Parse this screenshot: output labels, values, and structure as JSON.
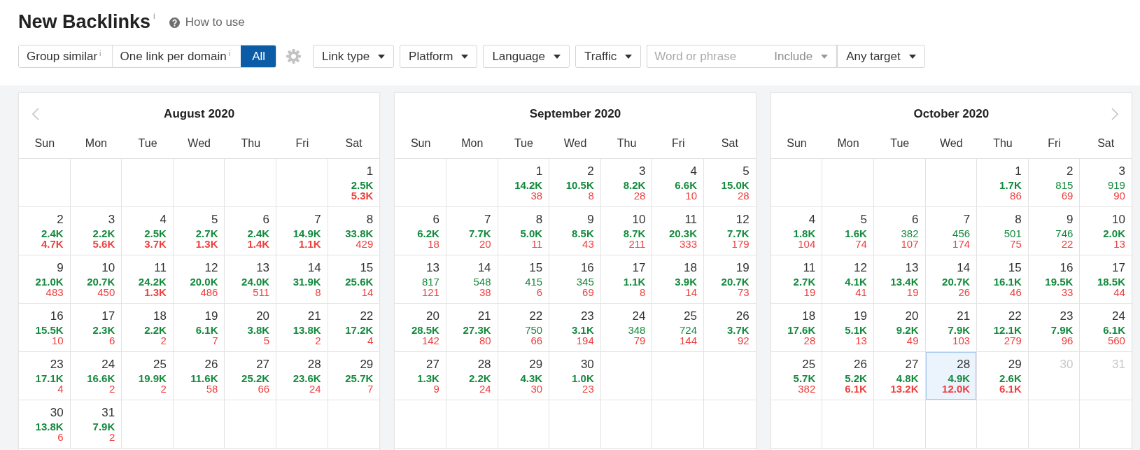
{
  "page": {
    "title": "New Backlinks",
    "title_info": "i",
    "help_link": "How to use"
  },
  "toolbar": {
    "segments": [
      {
        "label": "Group similar",
        "info": "i",
        "selected": false
      },
      {
        "label": "One link per domain",
        "info": "i",
        "selected": false
      },
      {
        "label": "All",
        "selected": true
      }
    ],
    "filters": [
      {
        "label": "Link type"
      },
      {
        "label": "Platform"
      },
      {
        "label": "Language"
      },
      {
        "label": "Traffic"
      }
    ],
    "search": {
      "placeholder": "Word or phrase",
      "dropdowns": [
        {
          "label": "Include",
          "disabled": true
        },
        {
          "label": "Any target",
          "disabled": false
        }
      ]
    }
  },
  "months": [
    {
      "title": "August 2020",
      "prev_arrow": true,
      "weekdays": [
        "Sun",
        "Mon",
        "Tue",
        "Wed",
        "Thu",
        "Fri",
        "Sat"
      ],
      "weeks": [
        [
          {
            "kind": "blank"
          },
          {
            "kind": "blank"
          },
          {
            "kind": "blank"
          },
          {
            "kind": "blank"
          },
          {
            "kind": "blank"
          },
          {
            "kind": "blank"
          },
          {
            "kind": "day",
            "day": "1",
            "new": "2.5K",
            "new_bold": true,
            "lost": "5.3K",
            "lost_bold": true,
            "selected": false,
            "disabled": false
          }
        ],
        [
          {
            "kind": "day",
            "day": "2",
            "new": "2.4K",
            "new_bold": true,
            "lost": "4.7K",
            "lost_bold": true,
            "selected": false,
            "disabled": false
          },
          {
            "kind": "day",
            "day": "3",
            "new": "2.2K",
            "new_bold": true,
            "lost": "5.6K",
            "lost_bold": true,
            "selected": false,
            "disabled": false
          },
          {
            "kind": "day",
            "day": "4",
            "new": "2.5K",
            "new_bold": true,
            "lost": "3.7K",
            "lost_bold": true,
            "selected": false,
            "disabled": false
          },
          {
            "kind": "day",
            "day": "5",
            "new": "2.7K",
            "new_bold": true,
            "lost": "1.3K",
            "lost_bold": true,
            "selected": false,
            "disabled": false
          },
          {
            "kind": "day",
            "day": "6",
            "new": "2.4K",
            "new_bold": true,
            "lost": "1.4K",
            "lost_bold": true,
            "selected": false,
            "disabled": false
          },
          {
            "kind": "day",
            "day": "7",
            "new": "14.9K",
            "new_bold": true,
            "lost": "1.1K",
            "lost_bold": true,
            "selected": false,
            "disabled": false
          },
          {
            "kind": "day",
            "day": "8",
            "new": "33.8K",
            "new_bold": true,
            "lost": "429",
            "lost_bold": false,
            "selected": false,
            "disabled": false
          }
        ],
        [
          {
            "kind": "day",
            "day": "9",
            "new": "21.0K",
            "new_bold": true,
            "lost": "483",
            "lost_bold": false,
            "selected": false,
            "disabled": false
          },
          {
            "kind": "day",
            "day": "10",
            "new": "20.7K",
            "new_bold": true,
            "lost": "450",
            "lost_bold": false,
            "selected": false,
            "disabled": false
          },
          {
            "kind": "day",
            "day": "11",
            "new": "24.2K",
            "new_bold": true,
            "lost": "1.3K",
            "lost_bold": true,
            "selected": false,
            "disabled": false
          },
          {
            "kind": "day",
            "day": "12",
            "new": "20.0K",
            "new_bold": true,
            "lost": "486",
            "lost_bold": false,
            "selected": false,
            "disabled": false
          },
          {
            "kind": "day",
            "day": "13",
            "new": "24.0K",
            "new_bold": true,
            "lost": "511",
            "lost_bold": false,
            "selected": false,
            "disabled": false
          },
          {
            "kind": "day",
            "day": "14",
            "new": "31.9K",
            "new_bold": true,
            "lost": "8",
            "lost_bold": false,
            "selected": false,
            "disabled": false
          },
          {
            "kind": "day",
            "day": "15",
            "new": "25.6K",
            "new_bold": true,
            "lost": "14",
            "lost_bold": false,
            "selected": false,
            "disabled": false
          }
        ],
        [
          {
            "kind": "day",
            "day": "16",
            "new": "15.5K",
            "new_bold": true,
            "lost": "10",
            "lost_bold": false,
            "selected": false,
            "disabled": false
          },
          {
            "kind": "day",
            "day": "17",
            "new": "2.3K",
            "new_bold": true,
            "lost": "6",
            "lost_bold": false,
            "selected": false,
            "disabled": false
          },
          {
            "kind": "day",
            "day": "18",
            "new": "2.2K",
            "new_bold": true,
            "lost": "2",
            "lost_bold": false,
            "selected": false,
            "disabled": false
          },
          {
            "kind": "day",
            "day": "19",
            "new": "6.1K",
            "new_bold": true,
            "lost": "7",
            "lost_bold": false,
            "selected": false,
            "disabled": false
          },
          {
            "kind": "day",
            "day": "20",
            "new": "3.8K",
            "new_bold": true,
            "lost": "5",
            "lost_bold": false,
            "selected": false,
            "disabled": false
          },
          {
            "kind": "day",
            "day": "21",
            "new": "13.8K",
            "new_bold": true,
            "lost": "2",
            "lost_bold": false,
            "selected": false,
            "disabled": false
          },
          {
            "kind": "day",
            "day": "22",
            "new": "17.2K",
            "new_bold": true,
            "lost": "4",
            "lost_bold": false,
            "selected": false,
            "disabled": false
          }
        ],
        [
          {
            "kind": "day",
            "day": "23",
            "new": "17.1K",
            "new_bold": true,
            "lost": "4",
            "lost_bold": false,
            "selected": false,
            "disabled": false
          },
          {
            "kind": "day",
            "day": "24",
            "new": "16.6K",
            "new_bold": true,
            "lost": "2",
            "lost_bold": false,
            "selected": false,
            "disabled": false
          },
          {
            "kind": "day",
            "day": "25",
            "new": "19.9K",
            "new_bold": true,
            "lost": "2",
            "lost_bold": false,
            "selected": false,
            "disabled": false
          },
          {
            "kind": "day",
            "day": "26",
            "new": "11.6K",
            "new_bold": true,
            "lost": "58",
            "lost_bold": false,
            "selected": false,
            "disabled": false
          },
          {
            "kind": "day",
            "day": "27",
            "new": "25.2K",
            "new_bold": true,
            "lost": "66",
            "lost_bold": false,
            "selected": false,
            "disabled": false
          },
          {
            "kind": "day",
            "day": "28",
            "new": "23.6K",
            "new_bold": true,
            "lost": "24",
            "lost_bold": false,
            "selected": false,
            "disabled": false
          },
          {
            "kind": "day",
            "day": "29",
            "new": "25.7K",
            "new_bold": true,
            "lost": "7",
            "lost_bold": false,
            "selected": false,
            "disabled": false
          }
        ],
        [
          {
            "kind": "day",
            "day": "30",
            "new": "13.8K",
            "new_bold": true,
            "lost": "6",
            "lost_bold": false,
            "selected": false,
            "disabled": false
          },
          {
            "kind": "day",
            "day": "31",
            "new": "7.9K",
            "new_bold": true,
            "lost": "2",
            "lost_bold": false,
            "selected": false,
            "disabled": false
          },
          {
            "kind": "blank"
          },
          {
            "kind": "blank"
          },
          {
            "kind": "blank"
          },
          {
            "kind": "blank"
          },
          {
            "kind": "blank"
          }
        ]
      ]
    },
    {
      "title": "September 2020",
      "weekdays": [
        "Sun",
        "Mon",
        "Tue",
        "Wed",
        "Thu",
        "Fri",
        "Sat"
      ],
      "weeks": [
        [
          {
            "kind": "blank"
          },
          {
            "kind": "blank"
          },
          {
            "kind": "day",
            "day": "1",
            "new": "14.2K",
            "new_bold": true,
            "lost": "38",
            "lost_bold": false,
            "selected": false,
            "disabled": false
          },
          {
            "kind": "day",
            "day": "2",
            "new": "10.5K",
            "new_bold": true,
            "lost": "8",
            "lost_bold": false,
            "selected": false,
            "disabled": false
          },
          {
            "kind": "day",
            "day": "3",
            "new": "8.2K",
            "new_bold": true,
            "lost": "28",
            "lost_bold": false,
            "selected": false,
            "disabled": false
          },
          {
            "kind": "day",
            "day": "4",
            "new": "6.6K",
            "new_bold": true,
            "lost": "10",
            "lost_bold": false,
            "selected": false,
            "disabled": false
          },
          {
            "kind": "day",
            "day": "5",
            "new": "15.0K",
            "new_bold": true,
            "lost": "28",
            "lost_bold": false,
            "selected": false,
            "disabled": false
          }
        ],
        [
          {
            "kind": "day",
            "day": "6",
            "new": "6.2K",
            "new_bold": true,
            "lost": "18",
            "lost_bold": false,
            "selected": false,
            "disabled": false
          },
          {
            "kind": "day",
            "day": "7",
            "new": "7.7K",
            "new_bold": true,
            "lost": "20",
            "lost_bold": false,
            "selected": false,
            "disabled": false
          },
          {
            "kind": "day",
            "day": "8",
            "new": "5.0K",
            "new_bold": true,
            "lost": "11",
            "lost_bold": false,
            "selected": false,
            "disabled": false
          },
          {
            "kind": "day",
            "day": "9",
            "new": "8.5K",
            "new_bold": true,
            "lost": "43",
            "lost_bold": false,
            "selected": false,
            "disabled": false
          },
          {
            "kind": "day",
            "day": "10",
            "new": "8.7K",
            "new_bold": true,
            "lost": "211",
            "lost_bold": false,
            "selected": false,
            "disabled": false
          },
          {
            "kind": "day",
            "day": "11",
            "new": "20.3K",
            "new_bold": true,
            "lost": "333",
            "lost_bold": false,
            "selected": false,
            "disabled": false
          },
          {
            "kind": "day",
            "day": "12",
            "new": "7.7K",
            "new_bold": true,
            "lost": "179",
            "lost_bold": false,
            "selected": false,
            "disabled": false
          }
        ],
        [
          {
            "kind": "day",
            "day": "13",
            "new": "817",
            "new_bold": false,
            "lost": "121",
            "lost_bold": false,
            "selected": false,
            "disabled": false
          },
          {
            "kind": "day",
            "day": "14",
            "new": "548",
            "new_bold": false,
            "lost": "38",
            "lost_bold": false,
            "selected": false,
            "disabled": false
          },
          {
            "kind": "day",
            "day": "15",
            "new": "415",
            "new_bold": false,
            "lost": "6",
            "lost_bold": false,
            "selected": false,
            "disabled": false
          },
          {
            "kind": "day",
            "day": "16",
            "new": "345",
            "new_bold": false,
            "lost": "69",
            "lost_bold": false,
            "selected": false,
            "disabled": false
          },
          {
            "kind": "day",
            "day": "17",
            "new": "1.1K",
            "new_bold": true,
            "lost": "8",
            "lost_bold": false,
            "selected": false,
            "disabled": false
          },
          {
            "kind": "day",
            "day": "18",
            "new": "3.9K",
            "new_bold": true,
            "lost": "14",
            "lost_bold": false,
            "selected": false,
            "disabled": false
          },
          {
            "kind": "day",
            "day": "19",
            "new": "20.7K",
            "new_bold": true,
            "lost": "73",
            "lost_bold": false,
            "selected": false,
            "disabled": false
          }
        ],
        [
          {
            "kind": "day",
            "day": "20",
            "new": "28.5K",
            "new_bold": true,
            "lost": "142",
            "lost_bold": false,
            "selected": false,
            "disabled": false
          },
          {
            "kind": "day",
            "day": "21",
            "new": "27.3K",
            "new_bold": true,
            "lost": "80",
            "lost_bold": false,
            "selected": false,
            "disabled": false
          },
          {
            "kind": "day",
            "day": "22",
            "new": "750",
            "new_bold": false,
            "lost": "66",
            "lost_bold": false,
            "selected": false,
            "disabled": false
          },
          {
            "kind": "day",
            "day": "23",
            "new": "3.1K",
            "new_bold": true,
            "lost": "194",
            "lost_bold": false,
            "selected": false,
            "disabled": false
          },
          {
            "kind": "day",
            "day": "24",
            "new": "348",
            "new_bold": false,
            "lost": "79",
            "lost_bold": false,
            "selected": false,
            "disabled": false
          },
          {
            "kind": "day",
            "day": "25",
            "new": "724",
            "new_bold": false,
            "lost": "144",
            "lost_bold": false,
            "selected": false,
            "disabled": false
          },
          {
            "kind": "day",
            "day": "26",
            "new": "3.7K",
            "new_bold": true,
            "lost": "92",
            "lost_bold": false,
            "selected": false,
            "disabled": false
          }
        ],
        [
          {
            "kind": "day",
            "day": "27",
            "new": "1.3K",
            "new_bold": true,
            "lost": "9",
            "lost_bold": false,
            "selected": false,
            "disabled": false
          },
          {
            "kind": "day",
            "day": "28",
            "new": "2.2K",
            "new_bold": true,
            "lost": "24",
            "lost_bold": false,
            "selected": false,
            "disabled": false
          },
          {
            "kind": "day",
            "day": "29",
            "new": "4.3K",
            "new_bold": true,
            "lost": "30",
            "lost_bold": false,
            "selected": false,
            "disabled": false
          },
          {
            "kind": "day",
            "day": "30",
            "new": "1.0K",
            "new_bold": true,
            "lost": "23",
            "lost_bold": false,
            "selected": false,
            "disabled": false
          },
          {
            "kind": "blank"
          },
          {
            "kind": "blank"
          },
          {
            "kind": "blank"
          }
        ],
        [
          {
            "kind": "blank"
          },
          {
            "kind": "blank"
          },
          {
            "kind": "blank"
          },
          {
            "kind": "blank"
          },
          {
            "kind": "blank"
          },
          {
            "kind": "blank"
          },
          {
            "kind": "blank"
          }
        ]
      ]
    },
    {
      "title": "October 2020",
      "next_arrow": true,
      "weekdays": [
        "Sun",
        "Mon",
        "Tue",
        "Wed",
        "Thu",
        "Fri",
        "Sat"
      ],
      "weeks": [
        [
          {
            "kind": "blank"
          },
          {
            "kind": "blank"
          },
          {
            "kind": "blank"
          },
          {
            "kind": "blank"
          },
          {
            "kind": "day",
            "day": "1",
            "new": "1.7K",
            "new_bold": true,
            "lost": "86",
            "lost_bold": false,
            "selected": false,
            "disabled": false
          },
          {
            "kind": "day",
            "day": "2",
            "new": "815",
            "new_bold": false,
            "lost": "69",
            "lost_bold": false,
            "selected": false,
            "disabled": false
          },
          {
            "kind": "day",
            "day": "3",
            "new": "919",
            "new_bold": false,
            "lost": "90",
            "lost_bold": false,
            "selected": false,
            "disabled": false
          }
        ],
        [
          {
            "kind": "day",
            "day": "4",
            "new": "1.8K",
            "new_bold": true,
            "lost": "104",
            "lost_bold": false,
            "selected": false,
            "disabled": false
          },
          {
            "kind": "day",
            "day": "5",
            "new": "1.6K",
            "new_bold": true,
            "lost": "74",
            "lost_bold": false,
            "selected": false,
            "disabled": false
          },
          {
            "kind": "day",
            "day": "6",
            "new": "382",
            "new_bold": false,
            "lost": "107",
            "lost_bold": false,
            "selected": false,
            "disabled": false
          },
          {
            "kind": "day",
            "day": "7",
            "new": "456",
            "new_bold": false,
            "lost": "174",
            "lost_bold": false,
            "selected": false,
            "disabled": false
          },
          {
            "kind": "day",
            "day": "8",
            "new": "501",
            "new_bold": false,
            "lost": "75",
            "lost_bold": false,
            "selected": false,
            "disabled": false
          },
          {
            "kind": "day",
            "day": "9",
            "new": "746",
            "new_bold": false,
            "lost": "22",
            "lost_bold": false,
            "selected": false,
            "disabled": false
          },
          {
            "kind": "day",
            "day": "10",
            "new": "2.0K",
            "new_bold": true,
            "lost": "13",
            "lost_bold": false,
            "selected": false,
            "disabled": false
          }
        ],
        [
          {
            "kind": "day",
            "day": "11",
            "new": "2.7K",
            "new_bold": true,
            "lost": "19",
            "lost_bold": false,
            "selected": false,
            "disabled": false
          },
          {
            "kind": "day",
            "day": "12",
            "new": "4.1K",
            "new_bold": true,
            "lost": "41",
            "lost_bold": false,
            "selected": false,
            "disabled": false
          },
          {
            "kind": "day",
            "day": "13",
            "new": "13.4K",
            "new_bold": true,
            "lost": "19",
            "lost_bold": false,
            "selected": false,
            "disabled": false
          },
          {
            "kind": "day",
            "day": "14",
            "new": "20.7K",
            "new_bold": true,
            "lost": "26",
            "lost_bold": false,
            "selected": false,
            "disabled": false
          },
          {
            "kind": "day",
            "day": "15",
            "new": "16.1K",
            "new_bold": true,
            "lost": "46",
            "lost_bold": false,
            "selected": false,
            "disabled": false
          },
          {
            "kind": "day",
            "day": "16",
            "new": "19.5K",
            "new_bold": true,
            "lost": "33",
            "lost_bold": false,
            "selected": false,
            "disabled": false
          },
          {
            "kind": "day",
            "day": "17",
            "new": "18.5K",
            "new_bold": true,
            "lost": "44",
            "lost_bold": false,
            "selected": false,
            "disabled": false
          }
        ],
        [
          {
            "kind": "day",
            "day": "18",
            "new": "17.6K",
            "new_bold": true,
            "lost": "28",
            "lost_bold": false,
            "selected": false,
            "disabled": false
          },
          {
            "kind": "day",
            "day": "19",
            "new": "5.1K",
            "new_bold": true,
            "lost": "13",
            "lost_bold": false,
            "selected": false,
            "disabled": false
          },
          {
            "kind": "day",
            "day": "20",
            "new": "9.2K",
            "new_bold": true,
            "lost": "49",
            "lost_bold": false,
            "selected": false,
            "disabled": false
          },
          {
            "kind": "day",
            "day": "21",
            "new": "7.9K",
            "new_bold": true,
            "lost": "103",
            "lost_bold": false,
            "selected": false,
            "disabled": false
          },
          {
            "kind": "day",
            "day": "22",
            "new": "12.1K",
            "new_bold": true,
            "lost": "279",
            "lost_bold": false,
            "selected": false,
            "disabled": false
          },
          {
            "kind": "day",
            "day": "23",
            "new": "7.9K",
            "new_bold": true,
            "lost": "96",
            "lost_bold": false,
            "selected": false,
            "disabled": false
          },
          {
            "kind": "day",
            "day": "24",
            "new": "6.1K",
            "new_bold": true,
            "lost": "560",
            "lost_bold": false,
            "selected": false,
            "disabled": false
          }
        ],
        [
          {
            "kind": "day",
            "day": "25",
            "new": "5.7K",
            "new_bold": true,
            "lost": "382",
            "lost_bold": false,
            "selected": false,
            "disabled": false
          },
          {
            "kind": "day",
            "day": "26",
            "new": "5.2K",
            "new_bold": true,
            "lost": "6.1K",
            "lost_bold": true,
            "selected": false,
            "disabled": false
          },
          {
            "kind": "day",
            "day": "27",
            "new": "4.8K",
            "new_bold": true,
            "lost": "13.2K",
            "lost_bold": true,
            "selected": false,
            "disabled": false
          },
          {
            "kind": "day",
            "day": "28",
            "new": "4.9K",
            "new_bold": true,
            "lost": "12.0K",
            "lost_bold": true,
            "selected": true,
            "disabled": false
          },
          {
            "kind": "day",
            "day": "29",
            "new": "2.6K",
            "new_bold": true,
            "lost": "6.1K",
            "lost_bold": true,
            "selected": false,
            "disabled": false
          },
          {
            "kind": "day",
            "day": "30",
            "selected": false,
            "disabled": true
          },
          {
            "kind": "day",
            "day": "31",
            "selected": false,
            "disabled": true
          }
        ],
        [
          {
            "kind": "blank"
          },
          {
            "kind": "blank"
          },
          {
            "kind": "blank"
          },
          {
            "kind": "blank"
          },
          {
            "kind": "blank"
          },
          {
            "kind": "blank"
          },
          {
            "kind": "blank"
          }
        ]
      ]
    }
  ]
}
